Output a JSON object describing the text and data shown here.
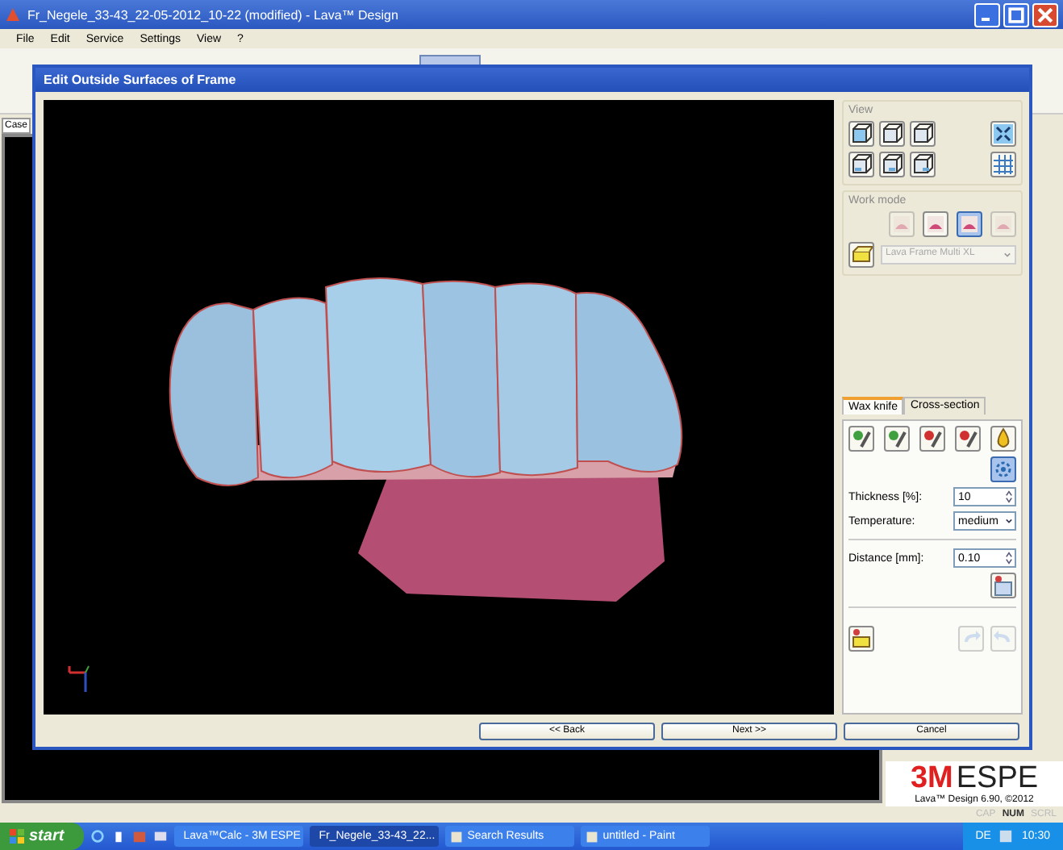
{
  "window": {
    "title": "Fr_Negele_33-43_22-05-2012_10-22 (modified) - Lava™ Design"
  },
  "menu": [
    "File",
    "Edit",
    "Service",
    "Settings",
    "View",
    "?"
  ],
  "case_tab": {
    "label": "Case"
  },
  "dialog": {
    "title": "Edit Outside Surfaces of Frame",
    "view": {
      "label": "View"
    },
    "work_mode": {
      "label": "Work mode",
      "modes": [
        {
          "selected": false,
          "disabled": true
        },
        {
          "selected": false,
          "disabled": false
        },
        {
          "selected": true,
          "disabled": false
        },
        {
          "selected": false,
          "disabled": true
        }
      ],
      "material": "Lava Frame Multi XL"
    },
    "tabs": [
      {
        "label": "Wax knife",
        "selected": true
      },
      {
        "label": "Cross-section",
        "selected": false
      }
    ],
    "fields": [
      {
        "kind": "spin",
        "label": "Thickness [%]:",
        "value": "10"
      },
      {
        "kind": "select",
        "label": "Temperature:",
        "value": "medium"
      },
      {
        "kind": "spin",
        "label": "Distance [mm]:",
        "value": "0.10"
      }
    ],
    "buttons": [
      "<< Back",
      "Next >>",
      "Cancel"
    ]
  },
  "brand": {
    "logo_mark": "3M",
    "logo_text": "ESPE",
    "version": "Lava™ Design 6.90, ©2012"
  },
  "status_indicators": [
    {
      "label": "CAP",
      "on": false
    },
    {
      "label": "NUM",
      "on": true
    },
    {
      "label": "SCRL",
      "on": false
    }
  ],
  "taskbar": {
    "start": "start",
    "tasks": [
      {
        "label": "Lava™Calc - 3M ESPE",
        "selected": false
      },
      {
        "label": "Fr_Negele_33-43_22...",
        "selected": true
      },
      {
        "label": "Search Results",
        "selected": false
      },
      {
        "label": "untitled - Paint",
        "selected": false
      }
    ],
    "language": "DE",
    "clock": "10:30"
  }
}
